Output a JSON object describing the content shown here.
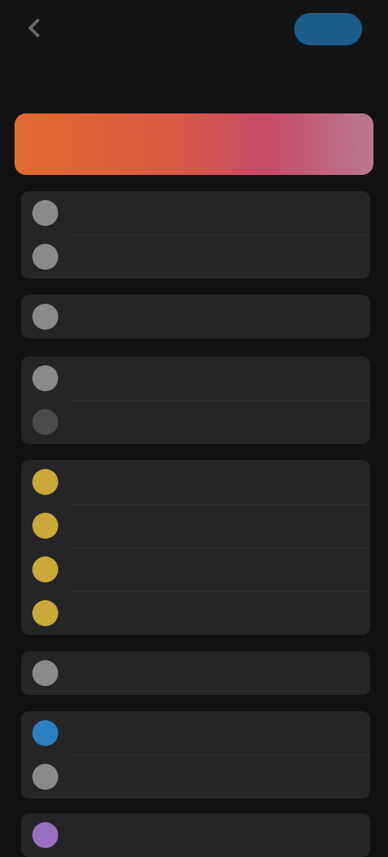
{
  "nav": {
    "back_label": "",
    "action_label": "",
    "title": "",
    "edit_label": ""
  },
  "colors": {
    "banner_start": "#e06a2c",
    "banner_end": "#b9788f",
    "action_button": "#1c5d8c",
    "icon_gray": "#8a8a8c",
    "icon_yellow": "#c9a93a",
    "icon_blue": "#2d7fc0",
    "icon_purple": "#9a6fc0"
  },
  "groups": [
    {
      "items": [
        {
          "label": "",
          "icon": "gray-circle-icon"
        },
        {
          "label": "",
          "icon": "gray-circle-icon"
        }
      ]
    },
    {
      "items": [
        {
          "label": "",
          "icon": "gray-circle-icon"
        }
      ]
    },
    {
      "items": [
        {
          "label": "",
          "icon": "gray-circle-icon"
        },
        {
          "label": "",
          "icon": "darkgray-circle-icon"
        }
      ]
    },
    {
      "items": [
        {
          "label": "",
          "icon": "yellow-circle-icon"
        },
        {
          "label": "",
          "icon": "yellow-circle-icon"
        },
        {
          "label": "",
          "icon": "yellow-circle-icon"
        },
        {
          "label": "",
          "icon": "yellow-circle-icon"
        }
      ]
    },
    {
      "items": [
        {
          "label": "",
          "icon": "gray-circle-icon"
        }
      ]
    },
    {
      "items": [
        {
          "label": "",
          "icon": "blue-circle-icon"
        },
        {
          "label": "",
          "icon": "gray-circle-icon"
        }
      ]
    },
    {
      "items": [
        {
          "label": "",
          "icon": "purple-circle-icon"
        }
      ]
    }
  ]
}
